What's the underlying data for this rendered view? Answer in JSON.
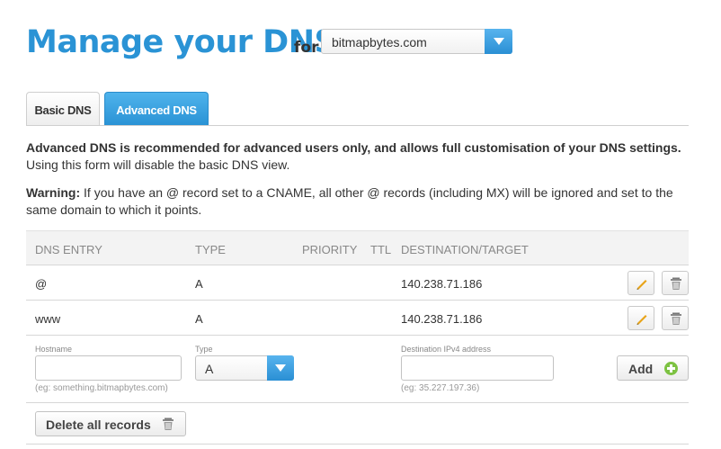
{
  "header": {
    "title": "Manage your DNS",
    "for_label": "for",
    "domain_selected": "bitmapbytes.com"
  },
  "tabs": [
    {
      "label": "Basic DNS",
      "active": false
    },
    {
      "label": "Advanced DNS",
      "active": true
    }
  ],
  "intro": {
    "bold": "Advanced DNS is recommended for advanced users only, and allows full customisation of your DNS settings.",
    "text": "Using this form will disable the basic DNS view."
  },
  "warning": {
    "label": "Warning:",
    "text": " If you have an @ record set to a CNAME, all other @ records (including MX) will be ignored and set to the same domain to which it points."
  },
  "table": {
    "headers": {
      "entry": "DNS ENTRY",
      "type": "TYPE",
      "priority": "PRIORITY",
      "ttl": "TTL",
      "destination": "DESTINATION/TARGET"
    },
    "rows": [
      {
        "entry": "@",
        "type": "A",
        "priority": "",
        "ttl": "",
        "destination": "140.238.71.186"
      },
      {
        "entry": "www",
        "type": "A",
        "priority": "",
        "ttl": "",
        "destination": "140.238.71.186"
      }
    ]
  },
  "form": {
    "hostname_label": "Hostname",
    "hostname_value": "",
    "hostname_hint": "(eg: something.bitmapbytes.com)",
    "type_label": "Type",
    "type_value": "A",
    "destination_label": "Destination IPv4 address",
    "destination_value": "",
    "destination_hint": "(eg: 35.227.197.36)",
    "add_label": "Add"
  },
  "footer": {
    "delete_all_label": "Delete all records"
  },
  "colors": {
    "brand_blue": "#2a93d5",
    "add_green": "#7dc242",
    "edit_orange": "#e8a317"
  },
  "icons": [
    "pencil-icon",
    "trash-icon",
    "plus-icon",
    "chevron-down-icon"
  ]
}
